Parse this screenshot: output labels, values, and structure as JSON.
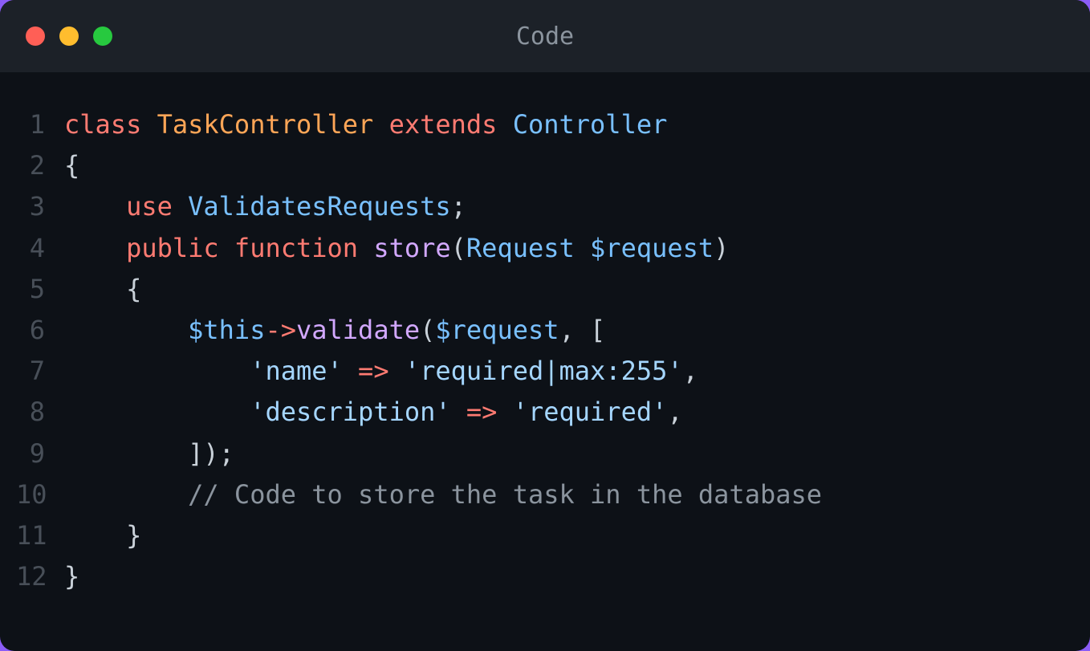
{
  "window": {
    "title": "Code"
  },
  "code": {
    "lines": [
      {
        "num": "1",
        "tokens": [
          {
            "cls": "tok-keyword",
            "text": "class"
          },
          {
            "cls": "tok-punct",
            "text": " "
          },
          {
            "cls": "tok-class-name",
            "text": "TaskController"
          },
          {
            "cls": "tok-punct",
            "text": " "
          },
          {
            "cls": "tok-keyword",
            "text": "extends"
          },
          {
            "cls": "tok-punct",
            "text": " "
          },
          {
            "cls": "tok-type",
            "text": "Controller"
          }
        ]
      },
      {
        "num": "2",
        "tokens": [
          {
            "cls": "tok-punct",
            "text": "{"
          }
        ]
      },
      {
        "num": "3",
        "tokens": [
          {
            "cls": "tok-punct",
            "text": "    "
          },
          {
            "cls": "tok-keyword",
            "text": "use"
          },
          {
            "cls": "tok-punct",
            "text": " "
          },
          {
            "cls": "tok-type",
            "text": "ValidatesRequests"
          },
          {
            "cls": "tok-punct",
            "text": ";"
          }
        ]
      },
      {
        "num": "4",
        "tokens": [
          {
            "cls": "tok-punct",
            "text": "    "
          },
          {
            "cls": "tok-keyword",
            "text": "public"
          },
          {
            "cls": "tok-punct",
            "text": " "
          },
          {
            "cls": "tok-keyword",
            "text": "function"
          },
          {
            "cls": "tok-punct",
            "text": " "
          },
          {
            "cls": "tok-method",
            "text": "store"
          },
          {
            "cls": "tok-punct",
            "text": "("
          },
          {
            "cls": "tok-type",
            "text": "Request"
          },
          {
            "cls": "tok-punct",
            "text": " "
          },
          {
            "cls": "tok-variable",
            "text": "$request"
          },
          {
            "cls": "tok-punct",
            "text": ")"
          }
        ]
      },
      {
        "num": "5",
        "tokens": [
          {
            "cls": "tok-punct",
            "text": "    {"
          }
        ]
      },
      {
        "num": "6",
        "tokens": [
          {
            "cls": "tok-punct",
            "text": "        "
          },
          {
            "cls": "tok-variable",
            "text": "$this"
          },
          {
            "cls": "tok-operator",
            "text": "->"
          },
          {
            "cls": "tok-method",
            "text": "validate"
          },
          {
            "cls": "tok-punct",
            "text": "("
          },
          {
            "cls": "tok-variable",
            "text": "$request"
          },
          {
            "cls": "tok-punct",
            "text": ", ["
          }
        ]
      },
      {
        "num": "7",
        "tokens": [
          {
            "cls": "tok-punct",
            "text": "            "
          },
          {
            "cls": "tok-string",
            "text": "'name'"
          },
          {
            "cls": "tok-punct",
            "text": " "
          },
          {
            "cls": "tok-operator",
            "text": "=>"
          },
          {
            "cls": "tok-punct",
            "text": " "
          },
          {
            "cls": "tok-string",
            "text": "'required|max:255'"
          },
          {
            "cls": "tok-punct",
            "text": ","
          }
        ]
      },
      {
        "num": "8",
        "tokens": [
          {
            "cls": "tok-punct",
            "text": "            "
          },
          {
            "cls": "tok-string",
            "text": "'description'"
          },
          {
            "cls": "tok-punct",
            "text": " "
          },
          {
            "cls": "tok-operator",
            "text": "=>"
          },
          {
            "cls": "tok-punct",
            "text": " "
          },
          {
            "cls": "tok-string",
            "text": "'required'"
          },
          {
            "cls": "tok-punct",
            "text": ","
          }
        ]
      },
      {
        "num": "9",
        "tokens": [
          {
            "cls": "tok-punct",
            "text": "        ]);"
          }
        ]
      },
      {
        "num": "10",
        "tokens": [
          {
            "cls": "tok-punct",
            "text": "        "
          },
          {
            "cls": "tok-comment",
            "text": "// Code to store the task in the database"
          }
        ]
      },
      {
        "num": "11",
        "tokens": [
          {
            "cls": "tok-punct",
            "text": "    }"
          }
        ]
      },
      {
        "num": "12",
        "tokens": [
          {
            "cls": "tok-punct",
            "text": "}"
          }
        ]
      }
    ]
  }
}
